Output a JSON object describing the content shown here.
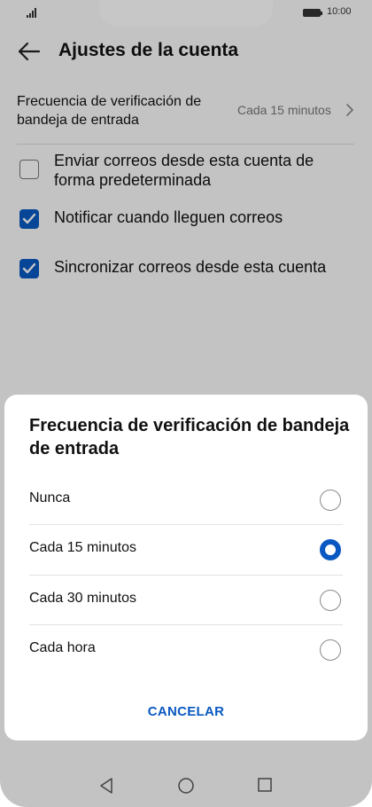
{
  "status_bar": {
    "time": "10:00",
    "signal_icon": "signal-icon",
    "battery_icon": "battery-icon"
  },
  "app_bar": {
    "title": "Ajustes de la cuenta",
    "back_icon": "back-arrow-icon"
  },
  "settings": {
    "frequency": {
      "label": "Frecuencia de verificación de bandeja de entrada",
      "value": "Cada 15 minutos"
    },
    "checkboxes": [
      {
        "label": "Enviar correos desde esta cuenta de forma predeterminada",
        "checked": false
      },
      {
        "label": "Notificar cuando lleguen correos",
        "checked": true
      },
      {
        "label": "Sincronizar correos desde esta cuenta",
        "checked": true
      }
    ]
  },
  "dialog": {
    "title": "Frecuencia de verificación de bandeja de entrada",
    "options": [
      {
        "label": "Nunca",
        "selected": false
      },
      {
        "label": "Cada 15 minutos",
        "selected": true
      },
      {
        "label": "Cada 30 minutos",
        "selected": false
      },
      {
        "label": "Cada hora",
        "selected": false
      }
    ],
    "cancel_label": "CANCELAR"
  },
  "nav_bar": {
    "back_icon": "nav-back-icon",
    "home_icon": "nav-home-icon",
    "recents_icon": "nav-recents-icon"
  },
  "colors": {
    "accent": "#0a59c2",
    "overlay": "rgba(0,0,0,0.22)"
  }
}
